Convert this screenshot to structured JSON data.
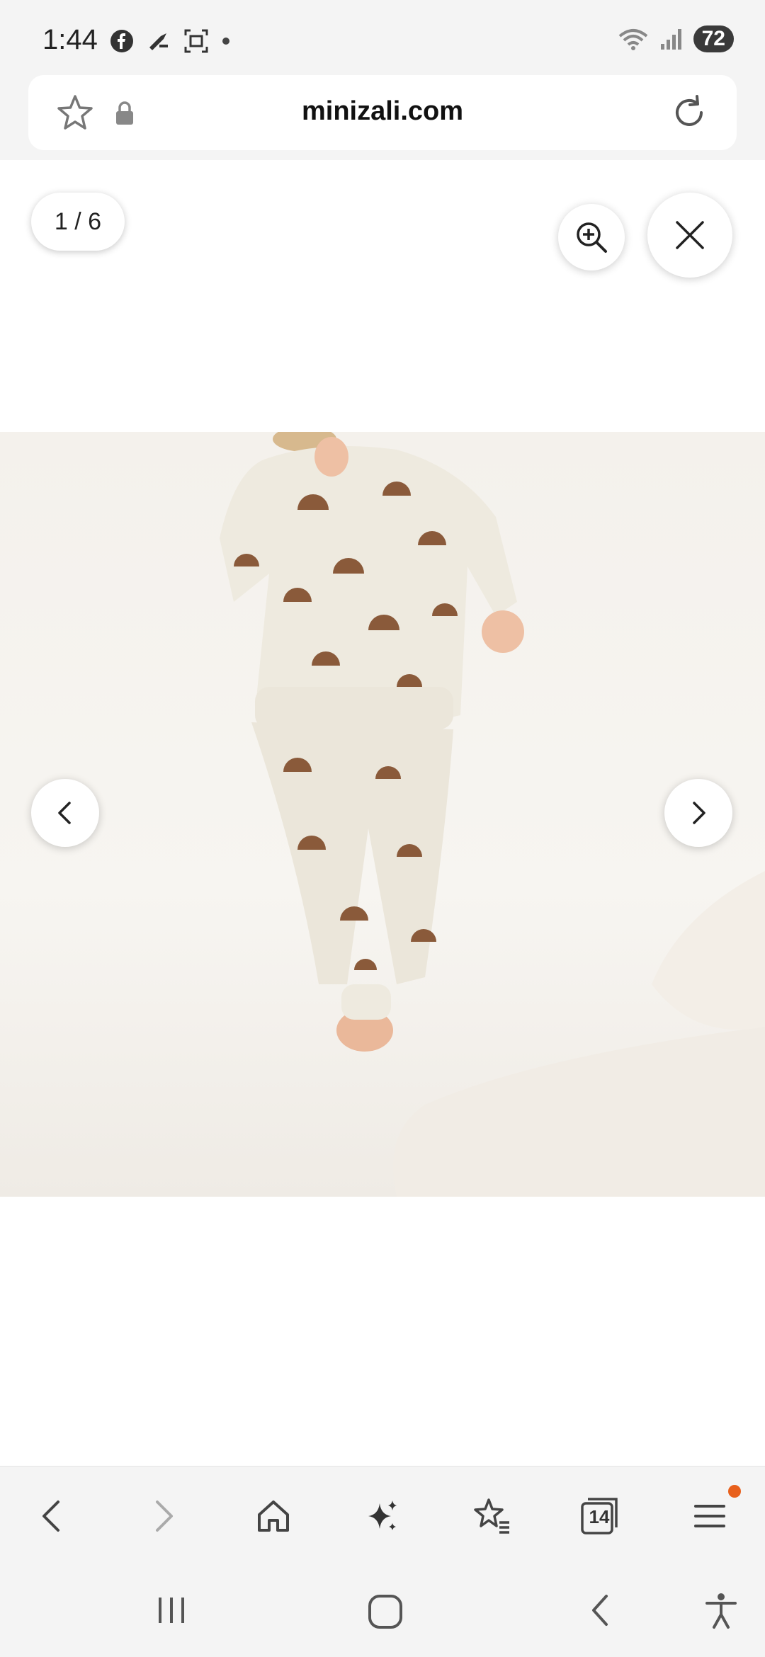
{
  "status_bar": {
    "time": "1:44",
    "battery": "72",
    "icons_left": [
      "facebook-icon",
      "tool-icon",
      "screenshot-icon",
      "dot-icon"
    ],
    "icons_right": [
      "wifi-icon",
      "signal-icon"
    ]
  },
  "url_bar": {
    "url": "minizali.com",
    "icons": [
      "star-icon",
      "lock-icon",
      "reload-icon"
    ]
  },
  "gallery": {
    "counter": "1 / 6",
    "zoom_icon": "zoom-in-icon",
    "close_icon": "close-icon",
    "prev_icon": "chevron-left-icon",
    "next_icon": "chevron-right-icon",
    "image_alt": "Child in cream waffle-knit set with brown shell print"
  },
  "toolbar": {
    "items": [
      "back-icon",
      "forward-icon",
      "home-icon",
      "sparkle-icon",
      "bookmarks-icon",
      "tabs-icon",
      "menu-icon"
    ],
    "tabs_count": "14",
    "accent": "#e8601c"
  },
  "nav_bar": {
    "items": [
      "recents-icon",
      "home-circle-icon",
      "back-nav-icon",
      "accessibility-icon"
    ]
  }
}
